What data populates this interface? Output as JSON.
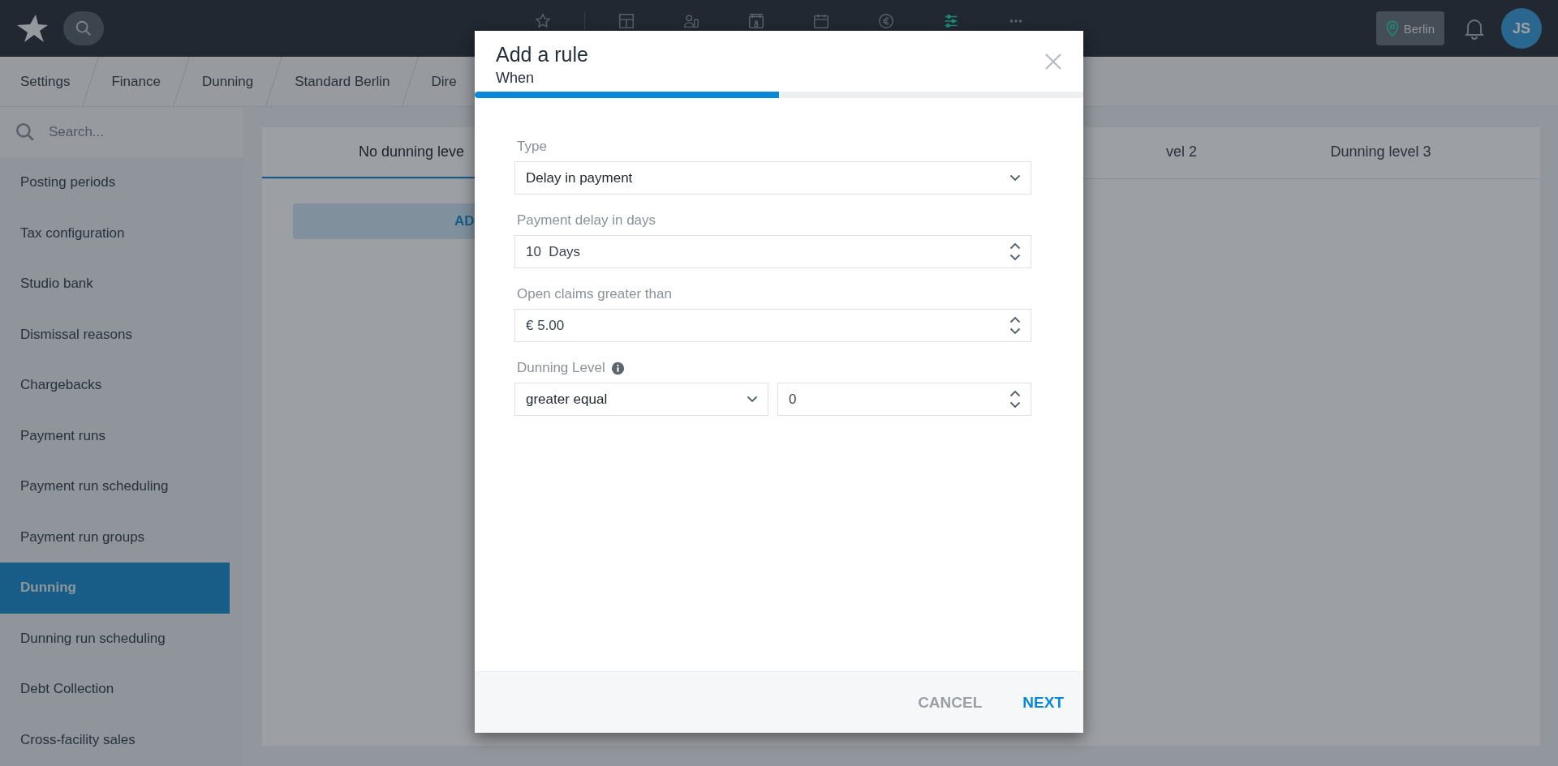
{
  "topbar": {
    "nav_icons": [
      {
        "kind": "star",
        "selected": false
      },
      {
        "kind": "layout",
        "selected": false
      },
      {
        "kind": "person-card",
        "selected": false
      },
      {
        "kind": "calendar-number",
        "selected": false
      },
      {
        "kind": "calendar",
        "selected": false
      },
      {
        "kind": "euro",
        "selected": false
      },
      {
        "kind": "sliders",
        "selected": true
      },
      {
        "kind": "more",
        "selected": false
      }
    ],
    "location": "Berlin",
    "avatar": "JS"
  },
  "breadcrumbs": [
    "Settings",
    "Finance",
    "Dunning",
    "Standard Berlin",
    "Dire"
  ],
  "sidebar": {
    "search": {
      "placeholder": "Search..."
    },
    "items": [
      {
        "label": "Posting periods",
        "selected": false
      },
      {
        "label": "Tax configuration",
        "selected": false
      },
      {
        "label": "Studio bank",
        "selected": false
      },
      {
        "label": "Dismissal reasons",
        "selected": false
      },
      {
        "label": "Chargebacks",
        "selected": false
      },
      {
        "label": "Payment runs",
        "selected": false
      },
      {
        "label": "Payment run scheduling",
        "selected": false
      },
      {
        "label": "Payment run groups",
        "selected": false
      },
      {
        "label": "Dunning",
        "selected": true
      },
      {
        "label": "Dunning run scheduling",
        "selected": false
      },
      {
        "label": "Debt Collection",
        "selected": false
      },
      {
        "label": "Cross-facility sales",
        "selected": false
      }
    ]
  },
  "content": {
    "tabs": [
      {
        "label": "No dunning leve",
        "selected": true
      },
      {
        "label": "vel 2",
        "selected": false
      },
      {
        "label": "Dunning level 3",
        "selected": false
      }
    ],
    "add_button": "AD"
  },
  "dialog": {
    "title": "Add a rule",
    "subtitle": "When",
    "progress": {
      "level": 0.5
    },
    "fields": [
      {
        "label": "Type",
        "kind": "select",
        "value": "Delay in payment"
      },
      {
        "label": "Payment delay in days",
        "kind": "number",
        "value": "10  Days"
      },
      {
        "label": "Open claims greater than",
        "kind": "number",
        "value": "€ 5.00"
      },
      {
        "label": "Dunning Level",
        "info": true,
        "kind": "pair",
        "operator": "greater equal",
        "value": "0"
      }
    ],
    "buttons": [
      {
        "label": "CANCEL",
        "kind": "secondary"
      },
      {
        "label": "NEXT",
        "kind": "primary"
      }
    ]
  }
}
